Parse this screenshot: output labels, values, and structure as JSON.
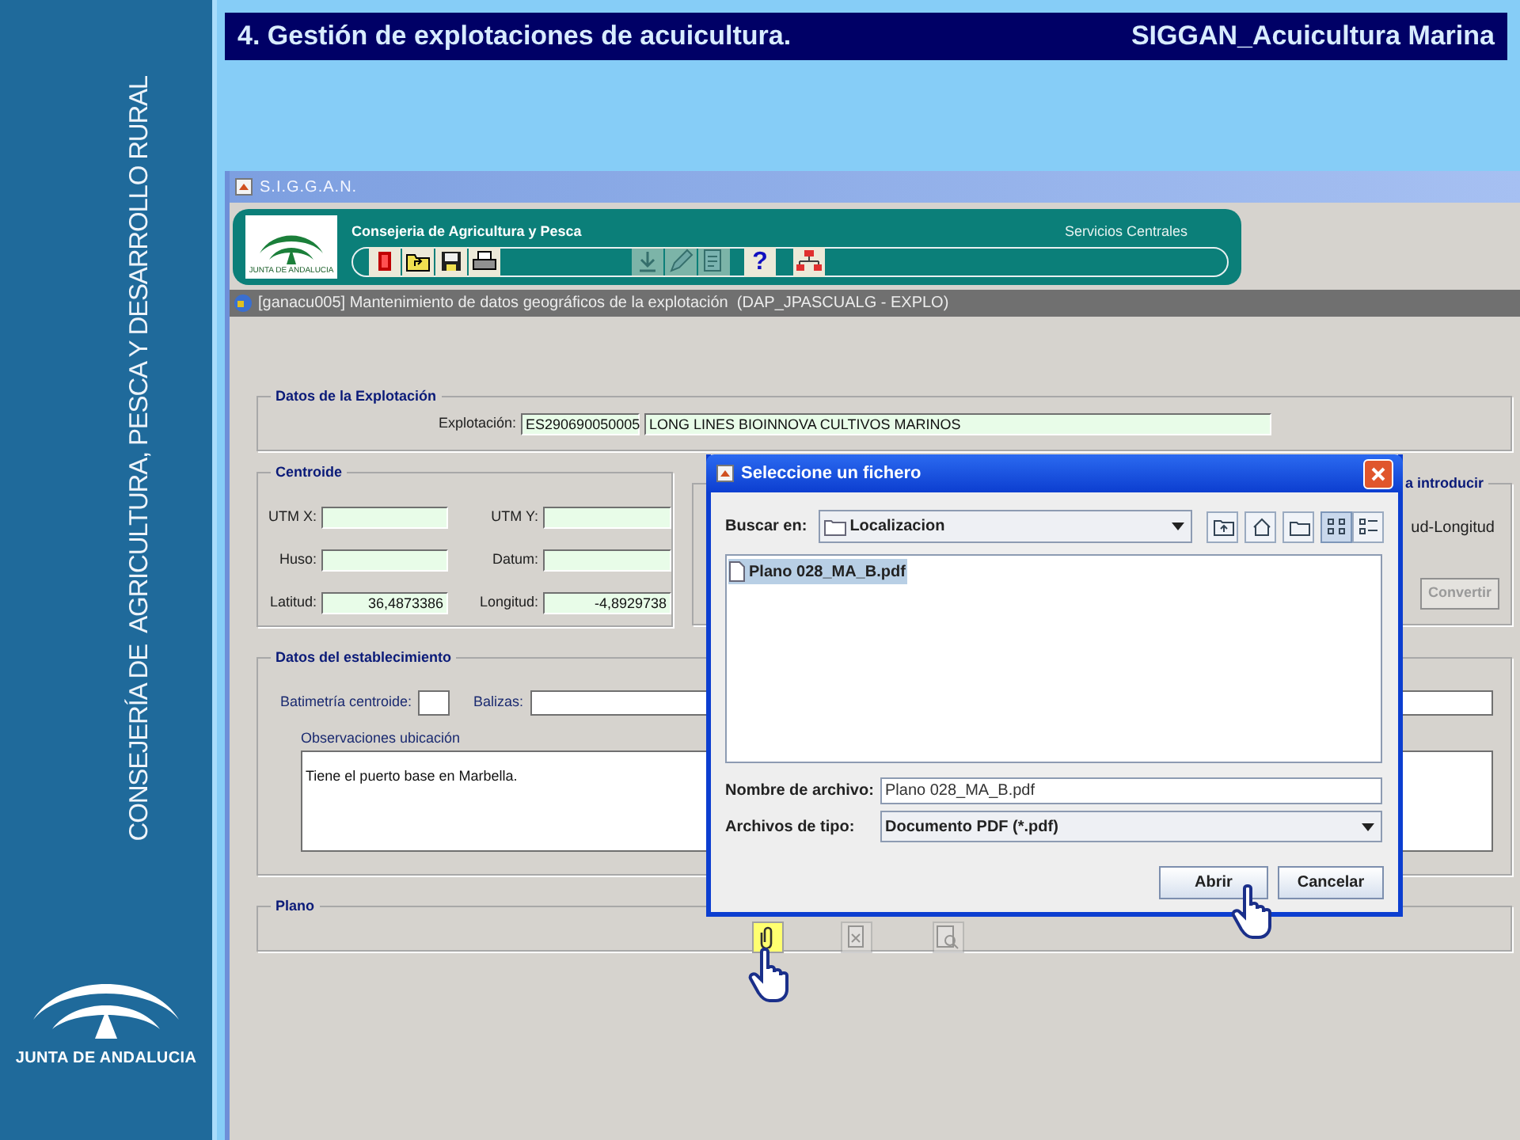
{
  "slide": {
    "title": "4. Gestión de explotaciones de acuicultura.",
    "subtitle": "SIGGAN_Acuicultura Marina",
    "side_text": "CONSEJERÍA DE  AGRICULTURA, PESCA Y DESARROLLO RURAL",
    "logo_text": "JUNTA DE ANDALUCIA"
  },
  "window": {
    "title": "S.I.G.G.A.N."
  },
  "header": {
    "logo_text": "JUNTA DE ANDALUCIA",
    "organization": "Consejeria de Agricultura y Pesca",
    "unit": "Servicios Centrales",
    "toolbar": [
      {
        "kind": "exit",
        "disabled": false
      },
      {
        "kind": "open",
        "disabled": false
      },
      {
        "kind": "save",
        "disabled": false
      },
      {
        "kind": "print",
        "disabled": false
      },
      {
        "kind": "download",
        "disabled": true
      },
      {
        "kind": "edit",
        "disabled": true
      },
      {
        "kind": "document",
        "disabled": true
      },
      {
        "kind": "help",
        "label": "?",
        "disabled": false
      },
      {
        "kind": "tree",
        "disabled": false
      }
    ]
  },
  "screen_title": "[ganacu005] Mantenimiento de datos geográficos de la explotación  (DAP_JPASCUALG - EXPLO)",
  "explotacion": {
    "legend": "Datos de la Explotación",
    "label": "Explotación:",
    "code": "ES290690050005",
    "name": "LONG LINES BIOINNOVA CULTIVOS MARINOS"
  },
  "centroide": {
    "legend": "Centroide",
    "fields": [
      {
        "label": "UTM X:"
      },
      {
        "label": "UTM Y:"
      },
      {
        "label": "Huso:"
      },
      {
        "label": "Datum:"
      },
      {
        "label": "Latitud:",
        "value": "36,4873386"
      },
      {
        "label": "Longitud:",
        "value": "-4,8929738"
      }
    ]
  },
  "conversion": {
    "legend": "a introducir",
    "option": "ud-Longitud",
    "button": {
      "label": "Convertir",
      "disabled": true
    }
  },
  "establecimiento": {
    "legend": "Datos del establecimiento",
    "depth_label": "Batimetría centroide:",
    "buoys_label": "Balizas:",
    "notes_label": "Observaciones ubicación",
    "notes": "Tiene el puerto base en Marbella."
  },
  "plano": {
    "legend": "Plano",
    "buttons": [
      {
        "kind": "attach",
        "highlighted": true,
        "disabled": false
      },
      {
        "kind": "delete",
        "highlighted": false,
        "disabled": true
      },
      {
        "kind": "view",
        "highlighted": false,
        "disabled": true
      }
    ]
  },
  "dialog": {
    "title": "Seleccione un fichero",
    "look_in_label": "Buscar en:",
    "look_in": "Localizacion",
    "tools": [
      {
        "kind": "up",
        "selected": false
      },
      {
        "kind": "home",
        "selected": false
      },
      {
        "kind": "new-folder",
        "selected": false
      },
      {
        "kind": "list",
        "selected": true
      },
      {
        "kind": "details",
        "selected": false
      }
    ],
    "files": [
      {
        "name": "Plano 028_MA_B.pdf",
        "selected": true
      }
    ],
    "filename_label": "Nombre de archivo:",
    "filename": "Plano 028_MA_B.pdf",
    "filetype_label": "Archivos de tipo:",
    "filetype": "Documento PDF (*.pdf)",
    "buttons": [
      {
        "label": "Abrir"
      },
      {
        "label": "Cancelar"
      }
    ]
  }
}
